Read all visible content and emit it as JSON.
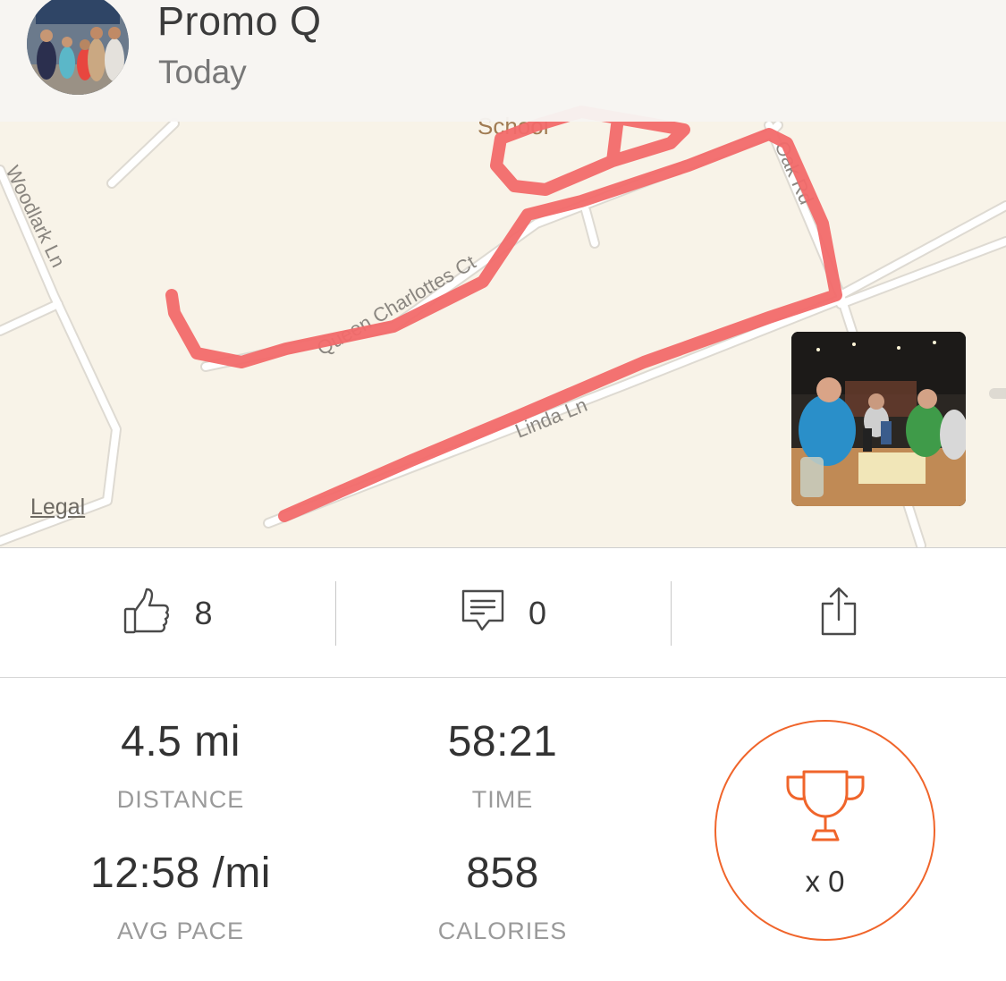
{
  "header": {
    "athlete_name": "Promo Q",
    "date": "Today"
  },
  "map": {
    "legal_label": "Legal",
    "street_labels": [
      "School",
      "Woodlark Ln",
      "Queen Charlottes Ct",
      "Linda Ln",
      "Oak Rd"
    ],
    "route_color": "#f26a6a"
  },
  "social": {
    "kudos_count": "8",
    "comments_count": "0"
  },
  "stats": {
    "distance": {
      "value": "4.5 mi",
      "label": "DISTANCE"
    },
    "time": {
      "value": "58:21",
      "label": "TIME"
    },
    "pace": {
      "value": "12:58 /mi",
      "label": "AVG PACE"
    },
    "calories": {
      "value": "858",
      "label": "CALORIES"
    }
  },
  "achievements": {
    "count_label": "x 0",
    "accent_color": "#f0652b"
  }
}
